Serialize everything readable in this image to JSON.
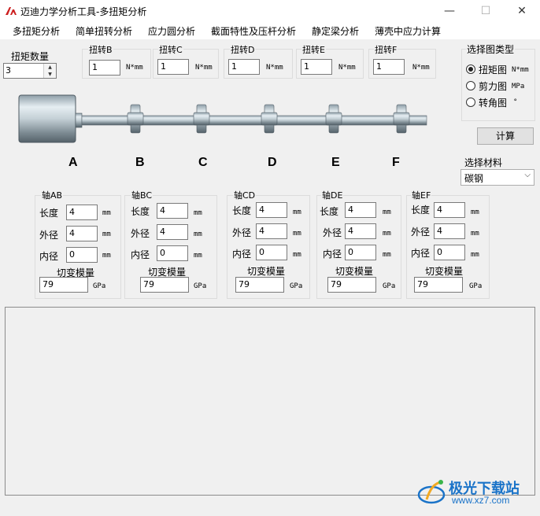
{
  "window": {
    "title": "迈迪力学分析工具-多扭矩分析",
    "controls": [
      "—",
      "☐",
      "✕"
    ]
  },
  "menu": [
    "多扭矩分析",
    "简单扭转分析",
    "应力圆分析",
    "截面特性及压杆分析",
    "静定梁分析",
    "薄壳中应力计算"
  ],
  "torque_count": {
    "label": "扭矩数量",
    "value": "3"
  },
  "torques": [
    {
      "label": "扭转B",
      "value": "1",
      "unit": "N*mm"
    },
    {
      "label": "扭转C",
      "value": "1",
      "unit": "N*mm"
    },
    {
      "label": "扭转D",
      "value": "1",
      "unit": "N*mm"
    },
    {
      "label": "扭转E",
      "value": "1",
      "unit": "N*mm"
    },
    {
      "label": "扭转F",
      "value": "1",
      "unit": "N*mm"
    }
  ],
  "chart_type": {
    "title": "选择图类型",
    "options": [
      {
        "label": "扭矩图",
        "unit": "N*mm",
        "selected": true
      },
      {
        "label": "剪力图",
        "unit": "MPa",
        "selected": false
      },
      {
        "label": "转角图",
        "unit": "°",
        "selected": false
      }
    ]
  },
  "calc_button": "计算",
  "material": {
    "label": "选择材料",
    "value": "碳钢"
  },
  "points": [
    "A",
    "B",
    "C",
    "D",
    "E",
    "F"
  ],
  "segment_field_labels": {
    "length": "长度",
    "outer": "外径",
    "inner": "内径",
    "modulus": "切变模量",
    "mm": "mm",
    "gpa": "GPa"
  },
  "segments": [
    {
      "title": "轴AB",
      "length": "4",
      "outer": "4",
      "inner": "0",
      "modulus": "79"
    },
    {
      "title": "轴BC",
      "length": "4",
      "outer": "4",
      "inner": "0",
      "modulus": "79"
    },
    {
      "title": "轴CD",
      "length": "4",
      "outer": "4",
      "inner": "0",
      "modulus": "79"
    },
    {
      "title": "轴DE",
      "length": "4",
      "outer": "4",
      "inner": "0",
      "modulus": "79"
    },
    {
      "title": "轴EF",
      "length": "4",
      "outer": "4",
      "inner": "0",
      "modulus": "79"
    }
  ],
  "watermark": {
    "name": "极光下载站",
    "url": "www.xz7.com"
  },
  "colors": {
    "accent": "#1a73c8",
    "logo": "#cc1f1f"
  }
}
